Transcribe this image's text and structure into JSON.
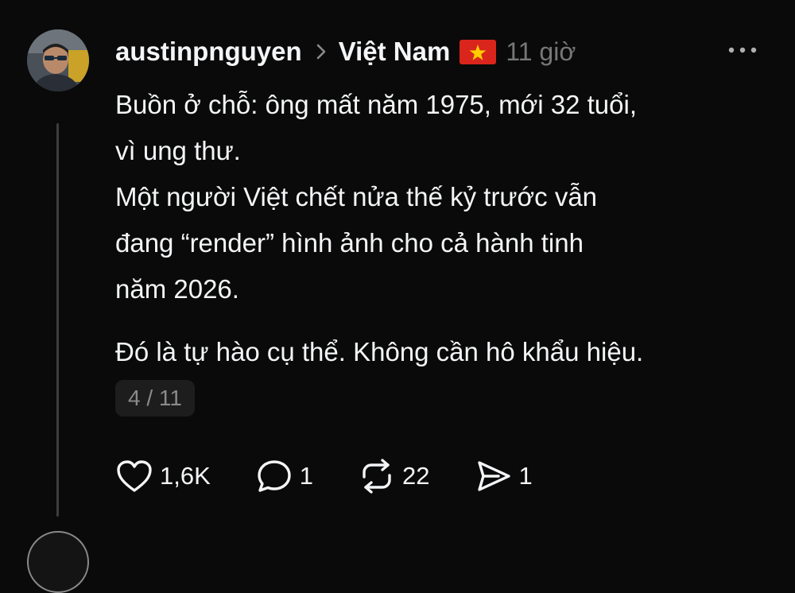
{
  "post": {
    "author": {
      "username": "austinpnguyen",
      "avatar_icon": "user-avatar"
    },
    "topic": "Việt Nam",
    "topic_flag_icon": "vietnam-flag-icon",
    "time": "11 giờ",
    "body_lines": [
      "Buồn ở chỗ: ông mất năm 1975, mới 32 tuổi,",
      "vì ung thư.",
      "Một người Việt chết nửa thế kỷ trước vẫn",
      "đang “render” hình ảnh cho cả hành tinh",
      "năm 2026."
    ],
    "body_para2": "Đó là tự hào cụ thể. Không cần hô khẩu hiệu.",
    "thread_counter": "4 / 11",
    "actions": {
      "like_count": "1,6K",
      "reply_count": "1",
      "repost_count": "22",
      "share_count": "1"
    }
  },
  "colors": {
    "background": "#0a0a0a",
    "text": "#f3f5f7",
    "secondary": "#777777",
    "thread_line": "#3d3d3d",
    "flag_red": "#da251d",
    "flag_star": "#ffcd00"
  }
}
